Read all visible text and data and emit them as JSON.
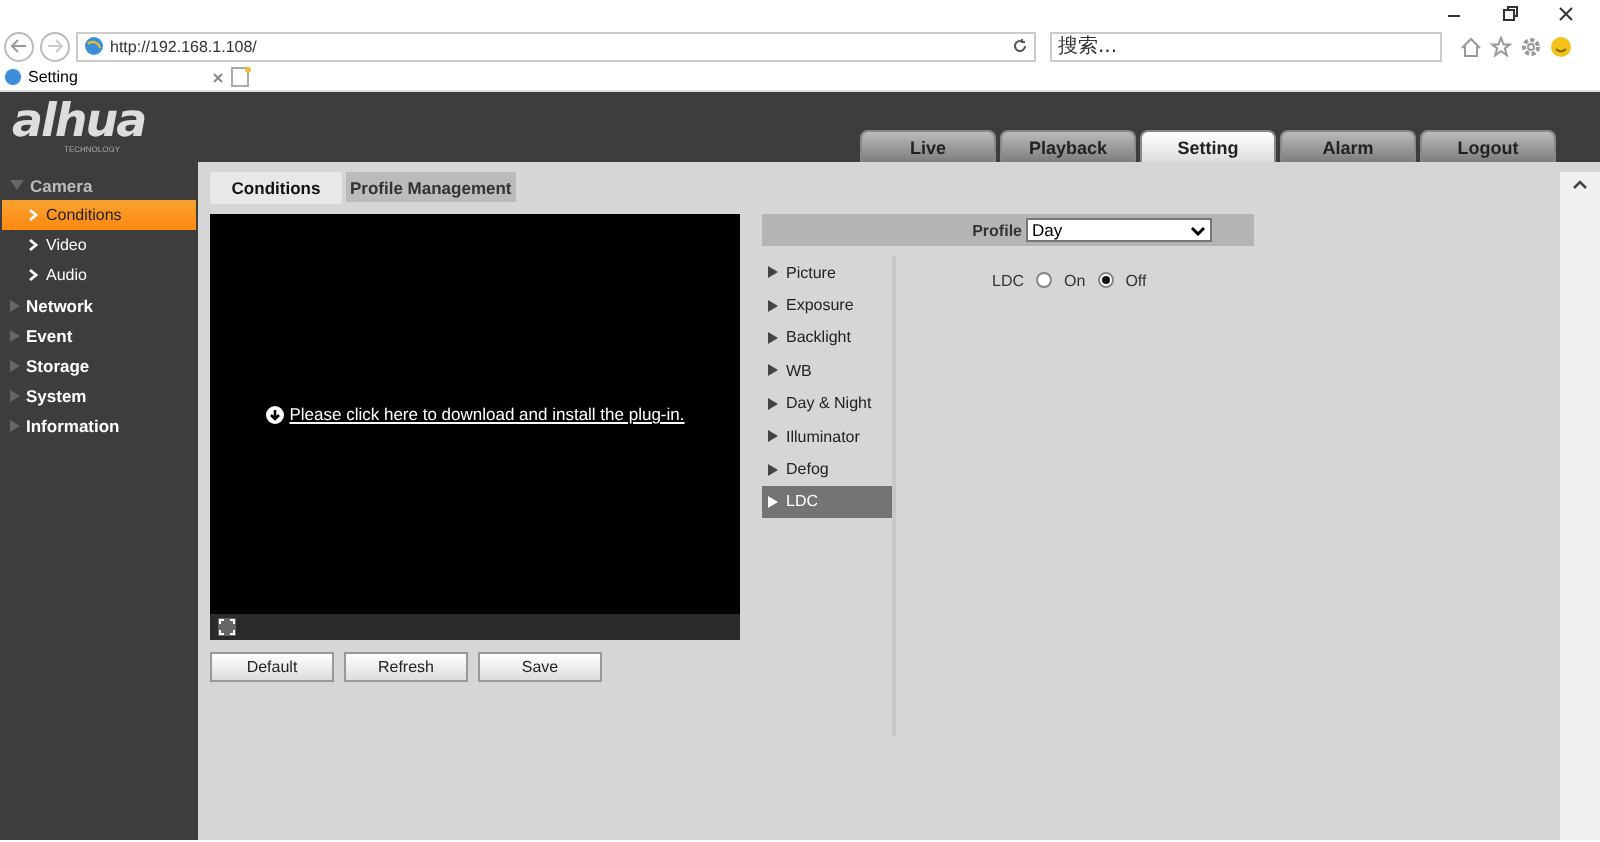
{
  "browser": {
    "address": "http://192.168.1.108/",
    "search": {
      "placeholder": "搜索..."
    },
    "tab": {
      "title": "Setting"
    }
  },
  "logo": {
    "name": "alhua",
    "tagline": "TECHNOLOGY"
  },
  "nav": [
    {
      "label": "Live",
      "selected": false
    },
    {
      "label": "Playback",
      "selected": false
    },
    {
      "label": "Setting",
      "selected": true
    },
    {
      "label": "Alarm",
      "selected": false
    },
    {
      "label": "Logout",
      "selected": false
    }
  ],
  "sidebar": {
    "items": [
      {
        "label": "Camera",
        "expanded": true,
        "children": [
          {
            "label": "Conditions",
            "selected": true
          },
          {
            "label": "Video",
            "selected": false
          },
          {
            "label": "Audio",
            "selected": false
          }
        ]
      },
      {
        "label": "Network",
        "expanded": false
      },
      {
        "label": "Event",
        "expanded": false
      },
      {
        "label": "Storage",
        "expanded": false
      },
      {
        "label": "System",
        "expanded": false
      },
      {
        "label": "Information",
        "expanded": false
      }
    ]
  },
  "tabs": [
    {
      "label": "Conditions",
      "selected": true
    },
    {
      "label": "Profile Management",
      "selected": false
    }
  ],
  "video": {
    "message": "Please click here to download and install the plug-in."
  },
  "buttons": [
    "Default",
    "Refresh",
    "Save"
  ],
  "profile": {
    "label": "Profile",
    "value": "Day"
  },
  "menu": [
    {
      "label": "Picture",
      "selected": false
    },
    {
      "label": "Exposure",
      "selected": false
    },
    {
      "label": "Backlight",
      "selected": false
    },
    {
      "label": "WB",
      "selected": false
    },
    {
      "label": "Day & Night",
      "selected": false
    },
    {
      "label": "Illuminator",
      "selected": false
    },
    {
      "label": "Defog",
      "selected": false
    },
    {
      "label": "LDC",
      "selected": true
    }
  ],
  "ldc": {
    "label": "LDC",
    "options": [
      {
        "label": "On",
        "selected": false
      },
      {
        "label": "Off",
        "selected": true
      }
    ]
  }
}
